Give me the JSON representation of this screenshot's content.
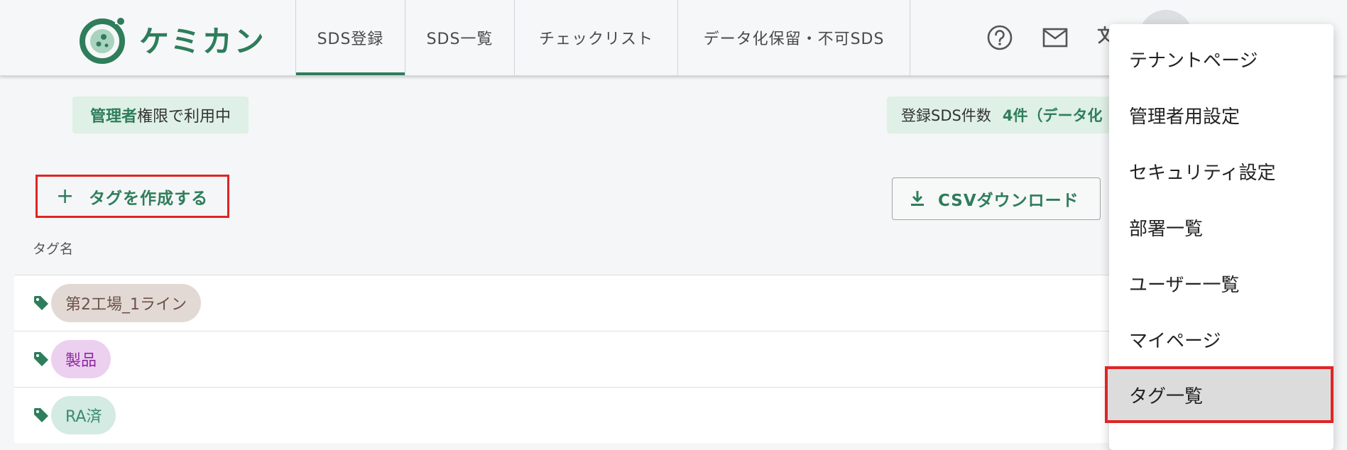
{
  "app": {
    "logo_text": "ケミカン"
  },
  "nav": {
    "tabs": [
      {
        "label": "SDS登録",
        "active": true
      },
      {
        "label": "SDS一覧",
        "active": false
      },
      {
        "label": "チェックリスト",
        "active": false
      },
      {
        "label": "データ化保留・不可SDS",
        "active": false
      }
    ]
  },
  "status": {
    "admin_strong": "管理者",
    "admin_rest": "権限で利用中",
    "count_label": "登録SDS件数",
    "count_value": "4件（データ化"
  },
  "actions": {
    "create_tag_label": "タグを作成する",
    "csv_download_label": "CSVダウンロード"
  },
  "table": {
    "column_header": "タグ名",
    "rows": [
      {
        "label": "第2工場_1ライン",
        "chip_bg": "#e3d9d4",
        "chip_fg": "#6b5148"
      },
      {
        "label": "製品",
        "chip_bg": "#ecd0ef",
        "chip_fg": "#8e2aa0"
      },
      {
        "label": "RA済",
        "chip_bg": "#d3ebe3",
        "chip_fg": "#3a8a71"
      }
    ]
  },
  "user_menu": {
    "items": [
      {
        "label": "テナントページ",
        "selected": false
      },
      {
        "label": "管理者用設定",
        "selected": false
      },
      {
        "label": "セキュリティ設定",
        "selected": false
      },
      {
        "label": "部署一覧",
        "selected": false
      },
      {
        "label": "ユーザー一覧",
        "selected": false
      },
      {
        "label": "マイページ",
        "selected": false
      },
      {
        "label": "タグ一覧",
        "selected": true
      }
    ]
  },
  "colors": {
    "accent": "#2e7d5b",
    "highlight_border": "#e02424",
    "badge_bg": "#dff0e6"
  },
  "icons": {
    "header": [
      "help-icon",
      "mail-icon",
      "translate-icon"
    ],
    "tag": "tag-icon",
    "download": "download-icon",
    "add": "plus-icon"
  }
}
